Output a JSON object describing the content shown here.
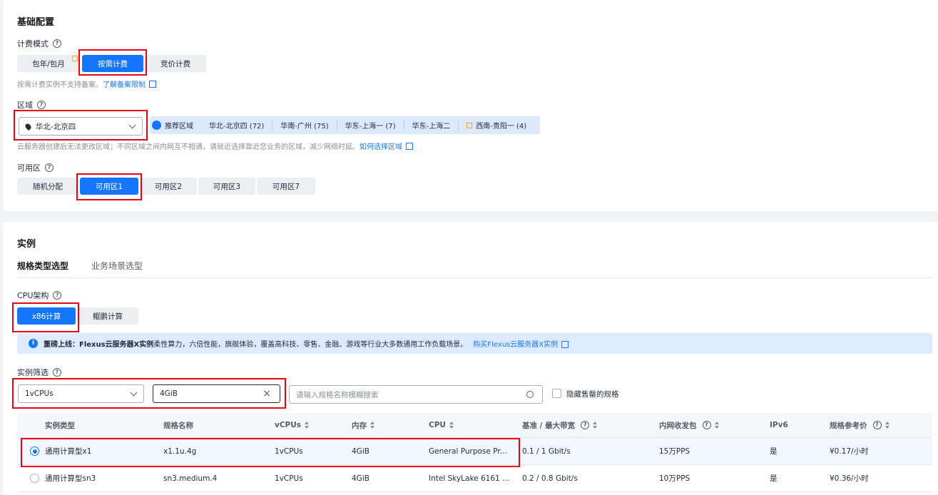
{
  "basic": {
    "title": "基础配置",
    "billing": {
      "label": "计费模式",
      "options": [
        "包年/包月",
        "按需计费",
        "竞价计费"
      ],
      "selected": "按需计费",
      "note": "按需计费实例不支持备案。",
      "note_link": "了解备案限制"
    },
    "region": {
      "label": "区域",
      "selected": "华北-北京四",
      "recommend_label": "推荐区域",
      "recommended": [
        "华北-北京四 (72)",
        "华南-广州 (75)",
        "华东-上海一 (7)",
        "华东-上海二",
        "西南-贵阳一 (4)"
      ],
      "note": "云服务器创建后无法更改区域；不同区域之间内网互不相通，请就近选择靠近您业务的区域，减少网络时延。",
      "note_link": "如何选择区域"
    },
    "az": {
      "label": "可用区",
      "options": [
        "随机分配",
        "可用区1",
        "可用区2",
        "可用区3",
        "可用区7"
      ],
      "selected": "可用区1"
    }
  },
  "instance": {
    "title": "实例",
    "tabs": [
      "规格类型选型",
      "业务场景选型"
    ],
    "active_tab": "规格类型选型",
    "cpu_arch": {
      "label": "CPU架构",
      "options": [
        "x86计算",
        "鲲鹏计算"
      ],
      "selected": "x86计算"
    },
    "notice": {
      "bold": "重磅上线：Flexus云服务器X实例",
      "text": " 柔性算力，六倍性能，旗舰体验，覆盖高科技、零售、金融、游戏等行业大多数通用工作负载场景。",
      "link": "购买Flexus云服务器X实例"
    },
    "filter": {
      "label": "实例筛选",
      "vcpus": "1vCPUs",
      "memory": "4GiB",
      "search_placeholder": "请输入规格名称模糊搜索",
      "hide_sold_out": "隐藏售罄的规格"
    },
    "table": {
      "headers": [
        "实例类型",
        "规格名称",
        "vCPUs",
        "内存",
        "CPU",
        "基准 / 最大带宽",
        "内网收发包",
        "IPv6",
        "规格参考价"
      ],
      "rows": [
        [
          "通用计算型x1",
          "x1.1u.4g",
          "1vCPUs",
          "4GiB",
          "General Purpose Pr...",
          "0.1 / 1 Gbit/s",
          "15万PPS",
          "是",
          "¥0.17/小时"
        ],
        [
          "通用计算型sn3",
          "sn3.medium.4",
          "1vCPUs",
          "4GiB",
          "Intel SkyLake 6161 ...",
          "0.2 / 0.8 Gbit/s",
          "10万PPS",
          "是",
          "¥0.36/小时"
        ]
      ],
      "selected_row": 0
    }
  },
  "colors": {
    "accent": "#1476ff",
    "highlight": "#e60012"
  }
}
